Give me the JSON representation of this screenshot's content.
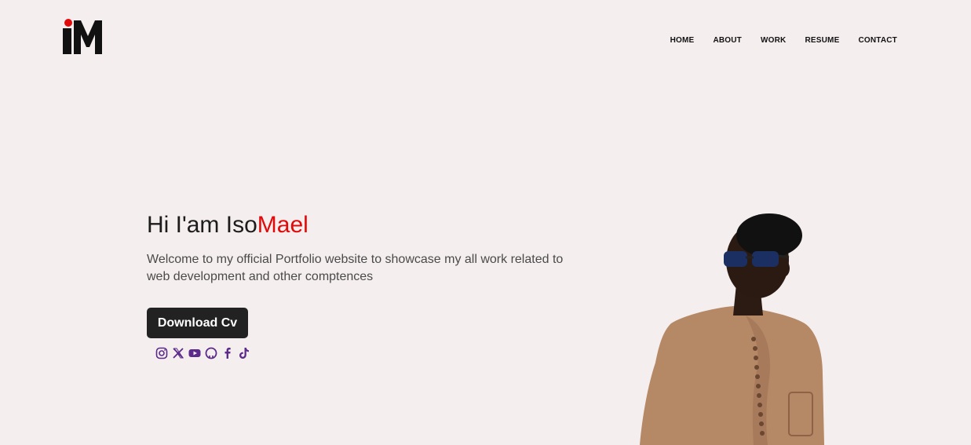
{
  "nav": {
    "items": [
      {
        "label": "HOME"
      },
      {
        "label": "ABOUT"
      },
      {
        "label": "WORK"
      },
      {
        "label": "RESUME"
      },
      {
        "label": "CONTACT"
      }
    ]
  },
  "hero": {
    "greeting": "Hi I'am Iso",
    "name_accent": "Mael",
    "description": "Welcome to my official Portfolio website to showcase my all work related to web development and other comptences",
    "cta_label": "Download Cv"
  },
  "socials": [
    "instagram-icon",
    "x-icon",
    "youtube-icon",
    "github-icon",
    "facebook-icon",
    "tiktok-icon"
  ],
  "colors": {
    "accent": "#e10a0a",
    "background": "#f4eeee",
    "button": "#222222",
    "social": "#5b2a8a"
  }
}
